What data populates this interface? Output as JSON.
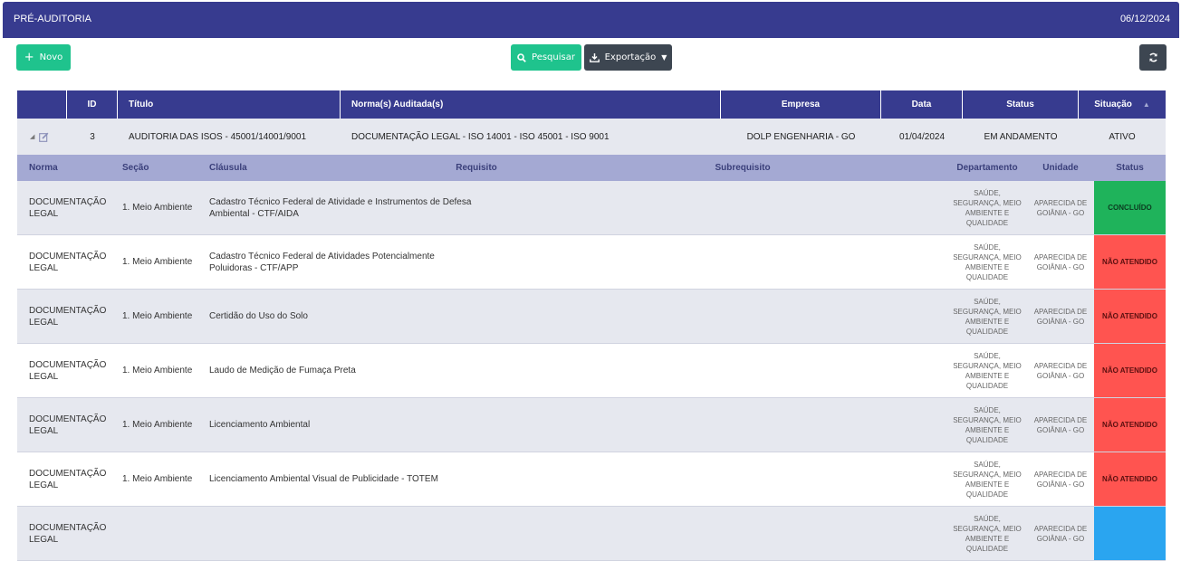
{
  "header": {
    "title": "PRÉ-AUDITORIA",
    "date": "06/12/2024"
  },
  "toolbar": {
    "new_label": "Novo",
    "search_label": "Pesquisar",
    "export_label": "Exportação"
  },
  "columns": {
    "id": "ID",
    "title": "Título",
    "norms": "Norma(s) Auditada(s)",
    "company": "Empresa",
    "date": "Data",
    "status": "Status",
    "situation": "Situação"
  },
  "audit": {
    "id": "3",
    "title": "AUDITORIA DAS ISOS - 45001/14001/9001",
    "norms": "DOCUMENTAÇÃO LEGAL - ISO 14001 - ISO 45001 - ISO 9001",
    "company": "DOLP ENGENHARIA - GO",
    "date": "01/04/2024",
    "status": "EM ANDAMENTO",
    "situation": "ATIVO"
  },
  "subcolumns": {
    "norma": "Norma",
    "secao": "Seção",
    "clausula": "Cláusula",
    "requisito": "Requisito",
    "subrequisito": "Subrequisito",
    "departamento": "Departamento",
    "unidade": "Unidade",
    "status": "Status"
  },
  "rows": [
    {
      "norma": "DOCUMENTAÇÃO LEGAL",
      "secao": "1. Meio Ambiente",
      "clausula": "Cadastro Técnico Federal de Atividade e Instrumentos de Defesa Ambiental - CTF/AIDA",
      "departamento": "SAÚDE, SEGURANÇA, MEIO AMBIENTE E QUALIDADE",
      "unidade": "APARECIDA DE GOIÂNIA - GO",
      "status": "CONCLUÍDO",
      "status_color": "#1fb35b"
    },
    {
      "norma": "DOCUMENTAÇÃO LEGAL",
      "secao": "1. Meio Ambiente",
      "clausula": "Cadastro Técnico Federal de Atividades Potencialmente Poluidoras - CTF/APP",
      "departamento": "SAÚDE, SEGURANÇA, MEIO AMBIENTE E QUALIDADE",
      "unidade": "APARECIDA DE GOIÂNIA - GO",
      "status": "NÃO ATENDIDO",
      "status_color": "#ff5450"
    },
    {
      "norma": "DOCUMENTAÇÃO LEGAL",
      "secao": "1. Meio Ambiente",
      "clausula": "Certidão do Uso do Solo",
      "departamento": "SAÚDE, SEGURANÇA, MEIO AMBIENTE E QUALIDADE",
      "unidade": "APARECIDA DE GOIÂNIA - GO",
      "status": "NÃO ATENDIDO",
      "status_color": "#ff5450"
    },
    {
      "norma": "DOCUMENTAÇÃO LEGAL",
      "secao": "1. Meio Ambiente",
      "clausula": "Laudo de Medição de Fumaça Preta",
      "departamento": "SAÚDE, SEGURANÇA, MEIO AMBIENTE E QUALIDADE",
      "unidade": "APARECIDA DE GOIÂNIA - GO",
      "status": "NÃO ATENDIDO",
      "status_color": "#ff5450"
    },
    {
      "norma": "DOCUMENTAÇÃO LEGAL",
      "secao": "1. Meio Ambiente",
      "clausula": "Licenciamento Ambiental",
      "departamento": "SAÚDE, SEGURANÇA, MEIO AMBIENTE E QUALIDADE",
      "unidade": "APARECIDA DE GOIÂNIA - GO",
      "status": "NÃO ATENDIDO",
      "status_color": "#ff5450"
    },
    {
      "norma": "DOCUMENTAÇÃO LEGAL",
      "secao": "1. Meio Ambiente",
      "clausula": "Licenciamento Ambiental Visual de Publicidade - TOTEM",
      "departamento": "SAÚDE, SEGURANÇA, MEIO AMBIENTE E QUALIDADE",
      "unidade": "APARECIDA DE GOIÂNIA - GO",
      "status": "NÃO ATENDIDO",
      "status_color": "#ff5450"
    },
    {
      "norma": "DOCUMENTAÇÃO LEGAL",
      "secao": "",
      "clausula": "",
      "departamento": "SAÚDE, SEGURANÇA, MEIO AMBIENTE E QUALIDADE",
      "unidade": "APARECIDA DE GOIÂNIA - GO",
      "status": "",
      "status_color": "#2aa5f0"
    }
  ],
  "icons": {
    "new": "plus-icon",
    "search": "search-icon",
    "export": "download-icon",
    "refresh": "refresh-icon",
    "expand": "caret-icon",
    "edit": "edit-icon",
    "sort": "sort-up-icon"
  }
}
